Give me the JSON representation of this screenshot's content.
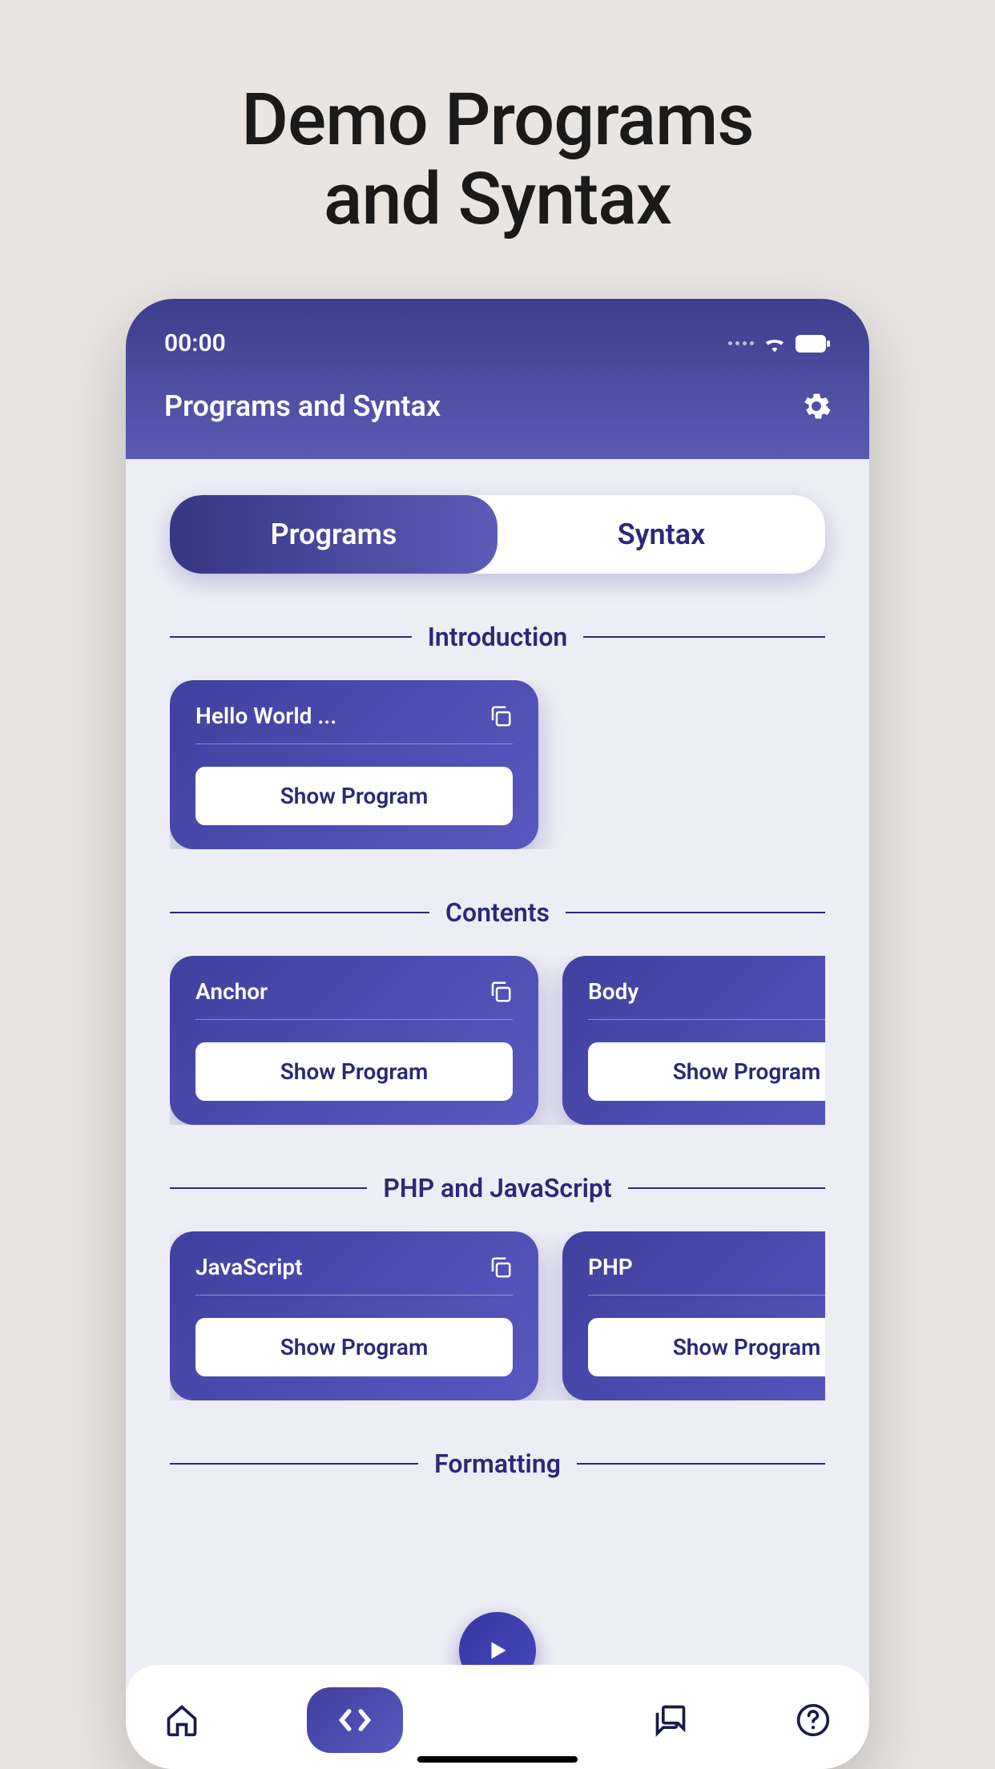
{
  "promo": {
    "line1": "Demo Programs",
    "line2": "and Syntax"
  },
  "status": {
    "time": "00:00"
  },
  "header": {
    "title": "Programs and Syntax"
  },
  "tabs": {
    "programs": "Programs",
    "syntax": "Syntax"
  },
  "sections": [
    {
      "title": "Introduction",
      "cards": [
        {
          "title": "Hello World ...",
          "button": "Show Program"
        }
      ]
    },
    {
      "title": "Contents",
      "cards": [
        {
          "title": "Anchor",
          "button": "Show Program"
        },
        {
          "title": "Body",
          "button": "Show Program"
        }
      ]
    },
    {
      "title": "PHP and JavaScript",
      "cards": [
        {
          "title": "JavaScript",
          "button": "Show Program"
        },
        {
          "title": "PHP",
          "button": "Show Program"
        }
      ]
    },
    {
      "title": "Formatting",
      "cards": []
    }
  ]
}
